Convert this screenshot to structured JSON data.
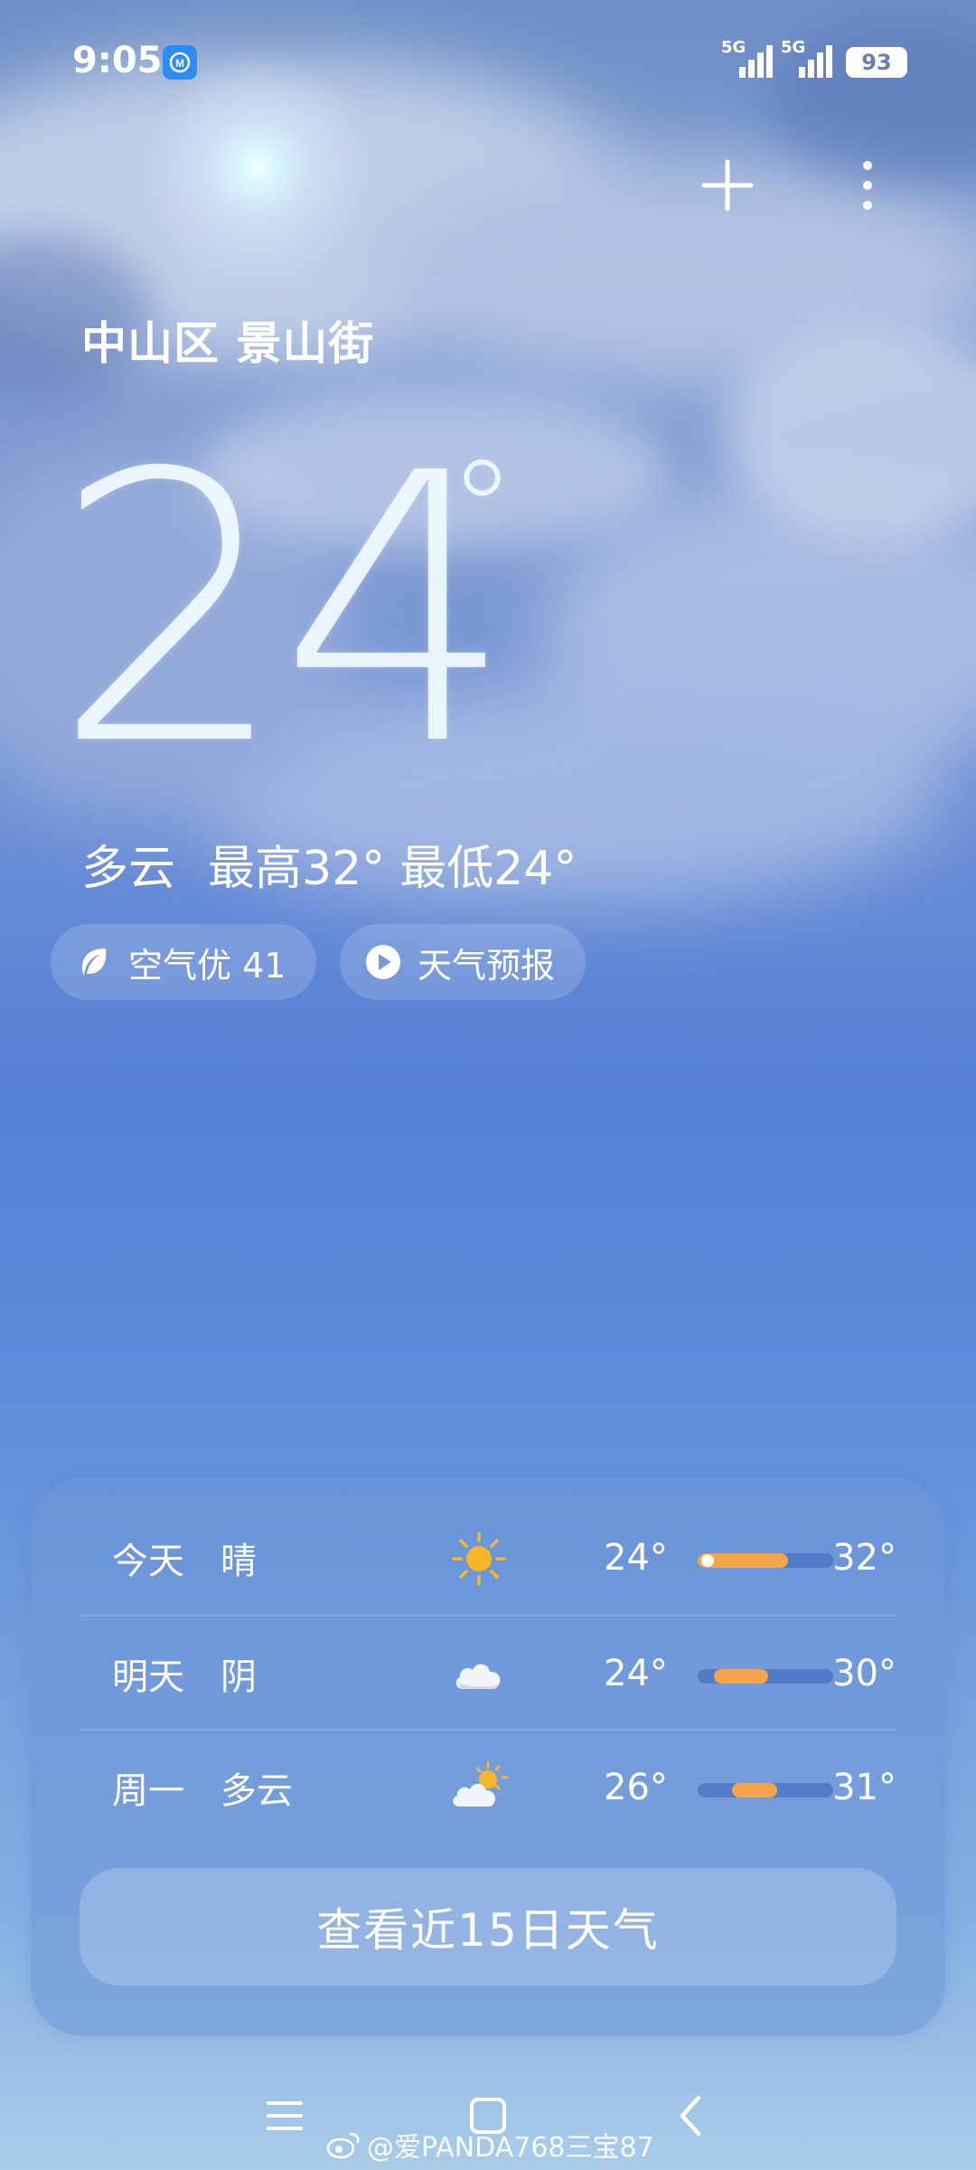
{
  "status_bar": {
    "time": "9:05",
    "network_1": "5G",
    "network_2": "5G",
    "battery": "93"
  },
  "header": {
    "add_icon": "plus-icon",
    "menu_icon": "more-vertical-icon"
  },
  "location": "中山区 景山街",
  "current": {
    "temperature": "24",
    "degree_symbol": "°",
    "condition": "多云",
    "high": "最高32°",
    "low": "最低24°"
  },
  "pills": {
    "air_quality": "空气优 41",
    "forecast_video": "天气预报"
  },
  "forecast": {
    "rows": [
      {
        "day": "今天",
        "condition": "晴",
        "icon": "sun-icon",
        "low": "24°",
        "high": "32°"
      },
      {
        "day": "明天",
        "condition": "阴",
        "icon": "cloud-icon",
        "low": "24°",
        "high": "30°"
      },
      {
        "day": "周一",
        "condition": "多云",
        "icon": "partly-cloudy-icon",
        "low": "26°",
        "high": "31°"
      }
    ],
    "more_button": "查看近15日天气"
  },
  "watermark": "@爱PANDA768三宝87",
  "colors": {
    "temp_bar": "#f5a449",
    "accent_blue": "#2d8cf0"
  }
}
